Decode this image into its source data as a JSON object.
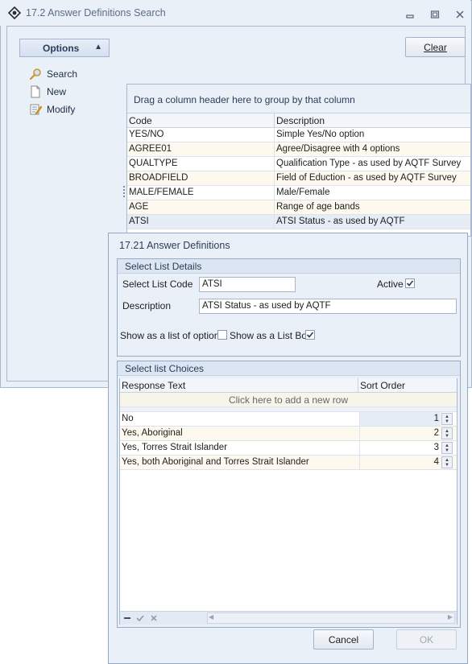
{
  "outer_window": {
    "title": "17.2 Answer Definitions Search",
    "options_label": "Options",
    "sidebar_items": [
      {
        "label": "Search",
        "icon": "search-icon"
      },
      {
        "label": "New",
        "icon": "new-document-icon"
      },
      {
        "label": "Modify",
        "icon": "modify-icon"
      }
    ],
    "clear_label": "Clear"
  },
  "grid": {
    "group_hint": "Drag a column header here to group by that column",
    "columns": [
      "Code",
      "Description"
    ],
    "rows": [
      {
        "code": "YES/NO",
        "description": "Simple Yes/No option"
      },
      {
        "code": "AGREE01",
        "description": "Agree/Disagree with 4 options"
      },
      {
        "code": "QUALTYPE",
        "description": "Qualification Type - as used by AQTF Survey"
      },
      {
        "code": "BROADFIELD",
        "description": "Field of Eduction - as used by AQTF Survey"
      },
      {
        "code": "MALE/FEMALE",
        "description": "Male/Female"
      },
      {
        "code": "AGE",
        "description": "Range of age bands"
      },
      {
        "code": "ATSI",
        "description": "ATSI Status - as used by AQTF"
      }
    ]
  },
  "dialog": {
    "title": "17.21 Answer Definitions",
    "details_group": "Select List Details",
    "code_label": "Select List Code",
    "code_value": "ATSI",
    "active_label": "Active",
    "active_checked": true,
    "description_label": "Description",
    "description_value": "ATSI Status - as used by AQTF",
    "options_label": "Show as a list of options",
    "options_checked": false,
    "listbox_label": "Show as a List Box",
    "listbox_checked": true,
    "choices_group": "Select list Choices",
    "choices_columns": [
      "Response Text",
      "Sort Order"
    ],
    "add_row_hint": "Click here to add a new row",
    "choices": [
      {
        "text": "No",
        "order": "1"
      },
      {
        "text": "Yes, Aboriginal",
        "order": "2"
      },
      {
        "text": "Yes, Torres Strait Islander",
        "order": "3"
      },
      {
        "text": "Yes, both Aboriginal and Torres Strait Islander",
        "order": "4"
      }
    ],
    "cancel_label": "Cancel",
    "ok_label": "OK"
  },
  "colors": {
    "accent": "#2b3d58",
    "panel": "#eaf0f8",
    "alt_row": "#fdf9ee"
  }
}
